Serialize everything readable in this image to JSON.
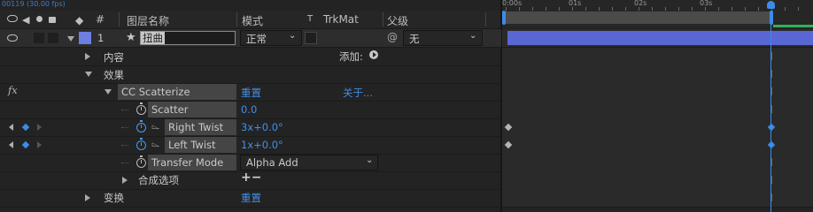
{
  "fps_text": "00119 (30.00 fps)",
  "header": {
    "hash": "#",
    "layer_name": "图层名称",
    "mode": "模式",
    "t": "T",
    "trkmat": "TrkMat",
    "parent": "父级"
  },
  "ruler": {
    "ticks": [
      "0:00s",
      "01s",
      "02s",
      "03s"
    ]
  },
  "layer": {
    "number": "1",
    "name": "扭曲",
    "mode": "正常",
    "parent": "无",
    "label_color": "#6d7fe0"
  },
  "rows": {
    "contents": "内容",
    "add_label": "添加:",
    "effects": "效果",
    "fx": "fx",
    "effect_name": "CC Scatterize",
    "reset": "重置",
    "about": "关于...",
    "scatter_label": "Scatter",
    "scatter_value": "0.0",
    "right_twist_label": "Right Twist",
    "right_twist_value": "3x+0.0°",
    "left_twist_label": "Left Twist",
    "left_twist_value": "1x+0.0°",
    "transfer_mode_label": "Transfer Mode",
    "transfer_mode_value": "Alpha Add",
    "composite_options": "合成选项",
    "composite_plusminus": "+−",
    "transform": "变换",
    "transform_reset": "重置"
  },
  "colors": {
    "accent_blue": "#3f8fe8",
    "layer_bar": "#5867d4",
    "work_area_green": "#2fb15a"
  }
}
